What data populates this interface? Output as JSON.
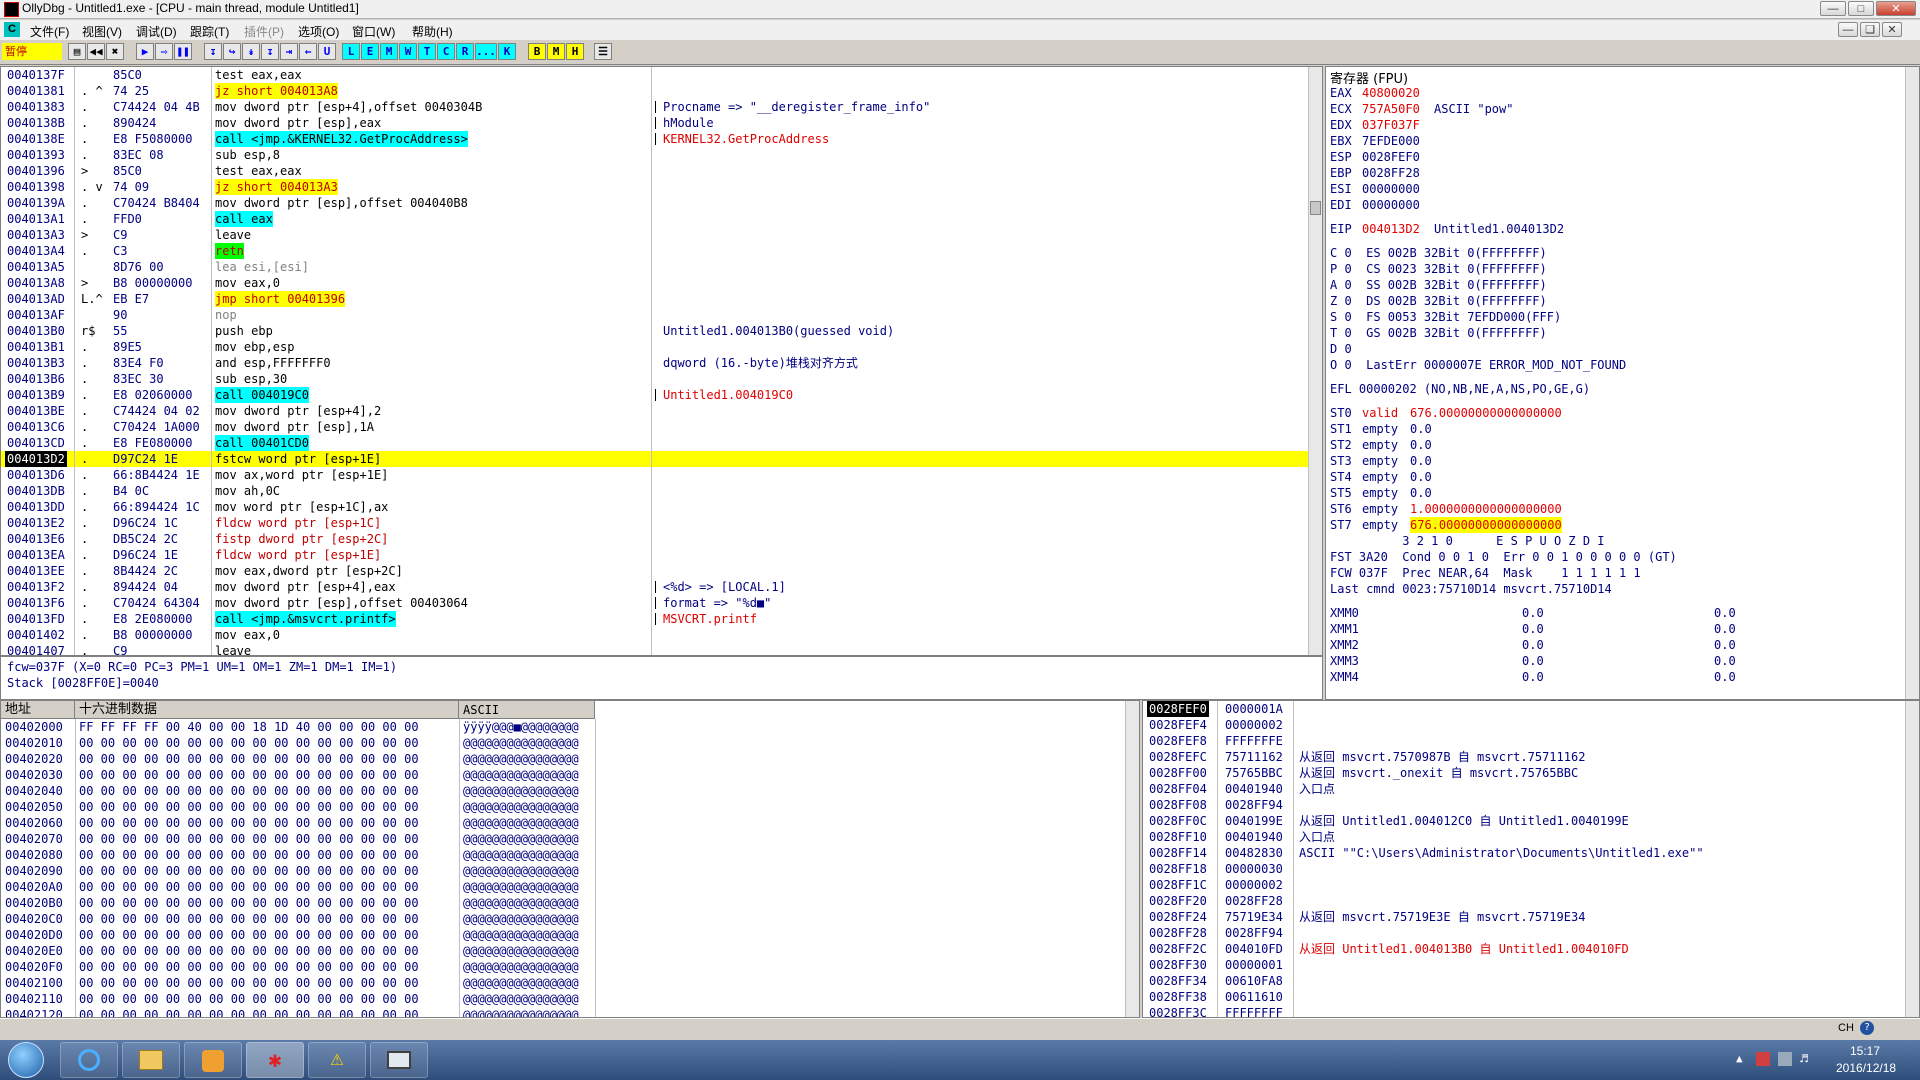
{
  "window": {
    "title": "OllyDbg - Untitled1.exe - [CPU - main thread, module Untitled1]",
    "status_label": "暂停"
  },
  "menu": [
    "文件(F)",
    "视图(V)",
    "调试(D)",
    "跟踪(T)",
    "插件(P)",
    "选项(O)",
    "窗口(W)",
    "帮助(H)"
  ],
  "toolbar": {
    "letters": [
      "L",
      "E",
      "M",
      "W",
      "T",
      "C",
      "R",
      "...",
      "K",
      "B",
      "M",
      "H"
    ]
  },
  "disasm": [
    {
      "addr": "0040137F",
      "mk": " ",
      "hex": "85C0",
      "asm": "test eax,eax",
      "asmcls": "",
      "cmt": ""
    },
    {
      "addr": "00401381",
      "mk": ". ^",
      "hex": "74 25",
      "asm": "jz short 004013A8",
      "asmcls": "jz",
      "cmt": ""
    },
    {
      "addr": "00401383",
      "mk": ".",
      "hex": "C74424 04 4B",
      "asm": "mov dword ptr [esp+4],offset 0040304B",
      "asmcls": "",
      "cmt": "Procname => \"__deregister_frame_info\"",
      "cmtcls": ""
    },
    {
      "addr": "0040138B",
      "mk": ".",
      "hex": "890424",
      "asm": "mov dword ptr [esp],eax",
      "asmcls": "",
      "cmt": "hModule",
      "cmtcls": "blue"
    },
    {
      "addr": "0040138E",
      "mk": ".",
      "hex": "E8 F5080000",
      "asm": "call <jmp.&KERNEL32.GetProcAddress>",
      "asmcls": "call",
      "cmt": "KERNEL32.GetProcAddress",
      "cmtcls": "red"
    },
    {
      "addr": "00401393",
      "mk": ".",
      "hex": "83EC 08",
      "asm": "sub esp,8",
      "asmcls": "",
      "cmt": ""
    },
    {
      "addr": "00401396",
      "mk": ">",
      "hex": "85C0",
      "asm": "test eax,eax",
      "asmcls": "",
      "cmt": ""
    },
    {
      "addr": "00401398",
      "mk": ". v",
      "hex": "74 09",
      "asm": "jz short 004013A3",
      "asmcls": "jz",
      "cmt": ""
    },
    {
      "addr": "0040139A",
      "mk": ".",
      "hex": "C70424 B8404",
      "asm": "mov dword ptr [esp],offset 004040B8",
      "asmcls": "",
      "cmt": ""
    },
    {
      "addr": "004013A1",
      "mk": ".",
      "hex": "FFD0",
      "asm": "call eax",
      "asmcls": "call",
      "cmt": ""
    },
    {
      "addr": "004013A3",
      "mk": ">",
      "hex": "C9",
      "asm": "leave",
      "asmcls": "",
      "cmt": ""
    },
    {
      "addr": "004013A4",
      "mk": ".",
      "hex": "C3",
      "asm": "retn",
      "asmcls": "retn",
      "cmt": ""
    },
    {
      "addr": "004013A5",
      "mk": " ",
      "hex": "8D76 00",
      "asm": "lea esi,[esi]",
      "asmcls": "gray",
      "cmt": ""
    },
    {
      "addr": "004013A8",
      "mk": ">",
      "hex": "B8 00000000",
      "asm": "mov eax,0",
      "asmcls": "",
      "cmt": ""
    },
    {
      "addr": "004013AD",
      "mk": "L.^",
      "hex": "EB E7",
      "asm": "jmp short 00401396",
      "asmcls": "jmp",
      "cmt": ""
    },
    {
      "addr": "004013AF",
      "mk": " ",
      "hex": "90",
      "asm": "nop",
      "asmcls": "gray",
      "cmt": ""
    },
    {
      "addr": "004013B0",
      "mk": "r$",
      "hex": "55",
      "asm": "push ebp",
      "asmcls": "",
      "cmt": "Untitled1.004013B0(guessed void)",
      "cmtcls": ""
    },
    {
      "addr": "004013B1",
      "mk": ".",
      "hex": "89E5",
      "asm": "mov ebp,esp",
      "asmcls": "",
      "cmt": ""
    },
    {
      "addr": "004013B3",
      "mk": ".",
      "hex": "83E4 F0",
      "asm": "and esp,FFFFFFF0",
      "asmcls": "",
      "cmt": "dqword (16.-byte)堆栈对齐方式",
      "cmtcls": ""
    },
    {
      "addr": "004013B6",
      "mk": ".",
      "hex": "83EC 30",
      "asm": "sub esp,30",
      "asmcls": "",
      "cmt": ""
    },
    {
      "addr": "004013B9",
      "mk": ".",
      "hex": "E8 02060000",
      "asm": "call 004019C0",
      "asmcls": "call",
      "cmt": "Untitled1.004019C0",
      "cmtcls": "red"
    },
    {
      "addr": "004013BE",
      "mk": ".",
      "hex": "C74424 04 02",
      "asm": "mov dword ptr [esp+4],2",
      "asmcls": "",
      "cmt": ""
    },
    {
      "addr": "004013C6",
      "mk": ".",
      "hex": "C70424 1A000",
      "asm": "mov dword ptr [esp],1A",
      "asmcls": "",
      "cmt": ""
    },
    {
      "addr": "004013CD",
      "mk": ".",
      "hex": "E8 FE080000",
      "asm": "call 00401CD0",
      "asmcls": "call",
      "cmt": ""
    },
    {
      "addr": "004013D2",
      "mk": ".",
      "hex": "D97C24 1E",
      "asm": "fstcw word ptr [esp+1E]",
      "asmcls": "",
      "cmt": "",
      "cur": true
    },
    {
      "addr": "004013D6",
      "mk": ".",
      "hex": "66:8B4424 1E",
      "asm": "mov ax,word ptr [esp+1E]",
      "asmcls": "",
      "cmt": ""
    },
    {
      "addr": "004013DB",
      "mk": ".",
      "hex": "B4 0C",
      "asm": "mov ah,0C",
      "asmcls": "",
      "cmt": ""
    },
    {
      "addr": "004013DD",
      "mk": ".",
      "hex": "66:894424 1C",
      "asm": "mov word ptr [esp+1C],ax",
      "asmcls": "",
      "cmt": ""
    },
    {
      "addr": "004013E2",
      "mk": ".",
      "hex": "D96C24 1C",
      "asm": "fldcw word ptr [esp+1C]",
      "asmcls": "fpu",
      "cmt": ""
    },
    {
      "addr": "004013E6",
      "mk": ".",
      "hex": "DB5C24 2C",
      "asm": "fistp dword ptr [esp+2C]",
      "asmcls": "fpu",
      "cmt": ""
    },
    {
      "addr": "004013EA",
      "mk": ".",
      "hex": "D96C24 1E",
      "asm": "fldcw word ptr [esp+1E]",
      "asmcls": "fpu",
      "cmt": ""
    },
    {
      "addr": "004013EE",
      "mk": ".",
      "hex": "8B4424 2C",
      "asm": "mov eax,dword ptr [esp+2C]",
      "asmcls": "",
      "cmt": ""
    },
    {
      "addr": "004013F2",
      "mk": ".",
      "hex": "894424 04",
      "asm": "mov dword ptr [esp+4],eax",
      "asmcls": "",
      "cmt": "<%d> => [LOCAL.1]",
      "cmtcls": ""
    },
    {
      "addr": "004013F6",
      "mk": ".",
      "hex": "C70424 64304",
      "asm": "mov dword ptr [esp],offset 00403064",
      "asmcls": "",
      "cmt": "format => \"%d■\"",
      "cmtcls": "blue"
    },
    {
      "addr": "004013FD",
      "mk": ".",
      "hex": "E8 2E080000",
      "asm": "call <jmp.&msvcrt.printf>",
      "asmcls": "call",
      "cmt": "MSVCRT.printf",
      "cmtcls": "red"
    },
    {
      "addr": "00401402",
      "mk": ".",
      "hex": "B8 00000000",
      "asm": "mov eax,0",
      "asmcls": "",
      "cmt": ""
    },
    {
      "addr": "00401407",
      "mk": ".",
      "hex": "C9",
      "asm": "leave",
      "asmcls": "",
      "cmt": ""
    }
  ],
  "info_lines": [
    "fcw=037F (X=0 RC=0 PC=3 PM=1 UM=1 OM=1 ZM=1 DM=1 IM=1)",
    "Stack [0028FF0E]=0040"
  ],
  "registers": {
    "header": "寄存器 (FPU)",
    "gp": [
      {
        "name": "EAX",
        "value": "40800020",
        "note": "",
        "red": true
      },
      {
        "name": "ECX",
        "value": "757A50F0",
        "note": "ASCII \"pow\"",
        "red": true
      },
      {
        "name": "EDX",
        "value": "037F037F",
        "note": "",
        "red": true
      },
      {
        "name": "EBX",
        "value": "7EFDE000",
        "note": "",
        "red": false
      },
      {
        "name": "ESP",
        "value": "0028FEF0",
        "note": "",
        "red": false
      },
      {
        "name": "EBP",
        "value": "0028FF28",
        "note": "",
        "red": false
      },
      {
        "name": "ESI",
        "value": "00000000",
        "note": "",
        "red": false
      },
      {
        "name": "EDI",
        "value": "00000000",
        "note": "",
        "red": false
      }
    ],
    "eip": {
      "name": "EIP",
      "value": "004013D2",
      "note": "Untitled1.004013D2"
    },
    "flags": [
      "C 0  ES 002B 32Bit 0(FFFFFFFF)",
      "P 0  CS 0023 32Bit 0(FFFFFFFF)",
      "A 0  SS 002B 32Bit 0(FFFFFFFF)",
      "Z 0  DS 002B 32Bit 0(FFFFFFFF)",
      "S 0  FS 0053 32Bit 7EFDD000(FFF)",
      "T 0  GS 002B 32Bit 0(FFFFFFFF)",
      "D 0",
      "O 0  LastErr 0000007E ERROR_MOD_NOT_FOUND"
    ],
    "efl": "EFL 00000202 (NO,NB,NE,A,NS,PO,GE,G)",
    "st": [
      {
        "name": "ST0",
        "tag": "valid",
        "value": "676.00000000000000000",
        "red": true
      },
      {
        "name": "ST1",
        "tag": "empty",
        "value": "0.0",
        "red": false
      },
      {
        "name": "ST2",
        "tag": "empty",
        "value": "0.0",
        "red": false
      },
      {
        "name": "ST3",
        "tag": "empty",
        "value": "0.0",
        "red": false
      },
      {
        "name": "ST4",
        "tag": "empty",
        "value": "0.0",
        "red": false
      },
      {
        "name": "ST5",
        "tag": "empty",
        "value": "0.0",
        "red": false
      },
      {
        "name": "ST6",
        "tag": "empty",
        "value": "1.0000000000000000000",
        "red": true
      },
      {
        "name": "ST7",
        "tag": "empty",
        "value": "676.00000000000000000",
        "red": true,
        "hl": true
      }
    ],
    "fpu_hdr": "          3 2 1 0      E S P U O Z D I",
    "fst": "FST 3A20  Cond 0 0 1 0  Err 0 0 1 0 0 0 0 0 (GT)",
    "fcw": "FCW 037F  Prec NEAR,64  Mask    1 1 1 1 1 1",
    "last": "Last cmnd 0023:75710D14 msvcrt.75710D14",
    "xmm": [
      {
        "name": "XMM0",
        "a": "0.0",
        "b": "0.0"
      },
      {
        "name": "XMM1",
        "a": "0.0",
        "b": "0.0"
      },
      {
        "name": "XMM2",
        "a": "0.0",
        "b": "0.0"
      },
      {
        "name": "XMM3",
        "a": "0.0",
        "b": "0.0"
      },
      {
        "name": "XMM4",
        "a": "0.0",
        "b": "0.0"
      }
    ]
  },
  "dump": {
    "col_addr": "地址",
    "col_hex": "十六进制数据",
    "col_ascii": "ASCII",
    "rows": [
      {
        "addr": "00402000",
        "hex": "FF FF FF FF 00 40 00 00 18 1D 40 00 00 00 00 00",
        "ascii": "ÿÿÿÿ@@@■@@@@@@@@"
      },
      {
        "addr": "00402010",
        "hex": "00 00 00 00 00 00 00 00 00 00 00 00 00 00 00 00",
        "ascii": "@@@@@@@@@@@@@@@@"
      },
      {
        "addr": "00402020",
        "hex": "00 00 00 00 00 00 00 00 00 00 00 00 00 00 00 00",
        "ascii": "@@@@@@@@@@@@@@@@"
      },
      {
        "addr": "00402030",
        "hex": "00 00 00 00 00 00 00 00 00 00 00 00 00 00 00 00",
        "ascii": "@@@@@@@@@@@@@@@@"
      },
      {
        "addr": "00402040",
        "hex": "00 00 00 00 00 00 00 00 00 00 00 00 00 00 00 00",
        "ascii": "@@@@@@@@@@@@@@@@"
      },
      {
        "addr": "00402050",
        "hex": "00 00 00 00 00 00 00 00 00 00 00 00 00 00 00 00",
        "ascii": "@@@@@@@@@@@@@@@@"
      },
      {
        "addr": "00402060",
        "hex": "00 00 00 00 00 00 00 00 00 00 00 00 00 00 00 00",
        "ascii": "@@@@@@@@@@@@@@@@"
      },
      {
        "addr": "00402070",
        "hex": "00 00 00 00 00 00 00 00 00 00 00 00 00 00 00 00",
        "ascii": "@@@@@@@@@@@@@@@@"
      },
      {
        "addr": "00402080",
        "hex": "00 00 00 00 00 00 00 00 00 00 00 00 00 00 00 00",
        "ascii": "@@@@@@@@@@@@@@@@"
      },
      {
        "addr": "00402090",
        "hex": "00 00 00 00 00 00 00 00 00 00 00 00 00 00 00 00",
        "ascii": "@@@@@@@@@@@@@@@@"
      },
      {
        "addr": "004020A0",
        "hex": "00 00 00 00 00 00 00 00 00 00 00 00 00 00 00 00",
        "ascii": "@@@@@@@@@@@@@@@@"
      },
      {
        "addr": "004020B0",
        "hex": "00 00 00 00 00 00 00 00 00 00 00 00 00 00 00 00",
        "ascii": "@@@@@@@@@@@@@@@@"
      },
      {
        "addr": "004020C0",
        "hex": "00 00 00 00 00 00 00 00 00 00 00 00 00 00 00 00",
        "ascii": "@@@@@@@@@@@@@@@@"
      },
      {
        "addr": "004020D0",
        "hex": "00 00 00 00 00 00 00 00 00 00 00 00 00 00 00 00",
        "ascii": "@@@@@@@@@@@@@@@@"
      },
      {
        "addr": "004020E0",
        "hex": "00 00 00 00 00 00 00 00 00 00 00 00 00 00 00 00",
        "ascii": "@@@@@@@@@@@@@@@@"
      },
      {
        "addr": "004020F0",
        "hex": "00 00 00 00 00 00 00 00 00 00 00 00 00 00 00 00",
        "ascii": "@@@@@@@@@@@@@@@@"
      },
      {
        "addr": "00402100",
        "hex": "00 00 00 00 00 00 00 00 00 00 00 00 00 00 00 00",
        "ascii": "@@@@@@@@@@@@@@@@"
      },
      {
        "addr": "00402110",
        "hex": "00 00 00 00 00 00 00 00 00 00 00 00 00 00 00 00",
        "ascii": "@@@@@@@@@@@@@@@@"
      },
      {
        "addr": "00402120",
        "hex": "00 00 00 00 00 00 00 00 00 00 00 00 00 00 00 00",
        "ascii": "@@@@@@@@@@@@@@@@"
      }
    ]
  },
  "stack": [
    {
      "addr": "0028FEF0",
      "val": "0000001A",
      "cmt": "",
      "sel": true
    },
    {
      "addr": "0028FEF4",
      "val": "00000002",
      "cmt": ""
    },
    {
      "addr": "0028FEF8",
      "val": "FFFFFFFE",
      "cmt": ""
    },
    {
      "addr": "0028FEFC",
      "val": "75711162",
      "cmt": "从返回 msvcrt.7570987B 自 msvcrt.75711162"
    },
    {
      "addr": "0028FF00",
      "val": "75765BBC",
      "cmt": "从返回 msvcrt._onexit 自 msvcrt.75765BBC"
    },
    {
      "addr": "0028FF04",
      "val": "00401940",
      "cmt": "入口点"
    },
    {
      "addr": "0028FF08",
      "val": "0028FF94",
      "cmt": ""
    },
    {
      "addr": "0028FF0C",
      "val": "0040199E",
      "cmt": "从返回 Untitled1.004012C0 自 Untitled1.0040199E"
    },
    {
      "addr": "0028FF10",
      "val": "00401940",
      "cmt": "入口点"
    },
    {
      "addr": "0028FF14",
      "val": "00482830",
      "cmt": "ASCII \"\"C:\\Users\\Administrator\\Documents\\Untitled1.exe\"\""
    },
    {
      "addr": "0028FF18",
      "val": "00000030",
      "cmt": ""
    },
    {
      "addr": "0028FF1C",
      "val": "00000002",
      "cmt": ""
    },
    {
      "addr": "0028FF20",
      "val": "0028FF28",
      "cmt": ""
    },
    {
      "addr": "0028FF24",
      "val": "75719E34",
      "cmt": "从返回 msvcrt.75719E3E 自 msvcrt.75719E34"
    },
    {
      "addr": "0028FF28",
      "val": "0028FF94",
      "cmt": ""
    },
    {
      "addr": "0028FF2C",
      "val": "004010FD",
      "cmt": "从返回 Untitled1.004013B0 自 Untitled1.004010FD",
      "red": true
    },
    {
      "addr": "0028FF30",
      "val": "00000001",
      "cmt": ""
    },
    {
      "addr": "0028FF34",
      "val": "00610FA8",
      "cmt": ""
    },
    {
      "addr": "0028FF38",
      "val": "00611610",
      "cmt": ""
    },
    {
      "addr": "0028FF3C",
      "val": "FFFFFFFF",
      "cmt": ""
    }
  ],
  "taskbar": {
    "time": "15:17",
    "date": "2016/12/18",
    "lang": "CH"
  }
}
